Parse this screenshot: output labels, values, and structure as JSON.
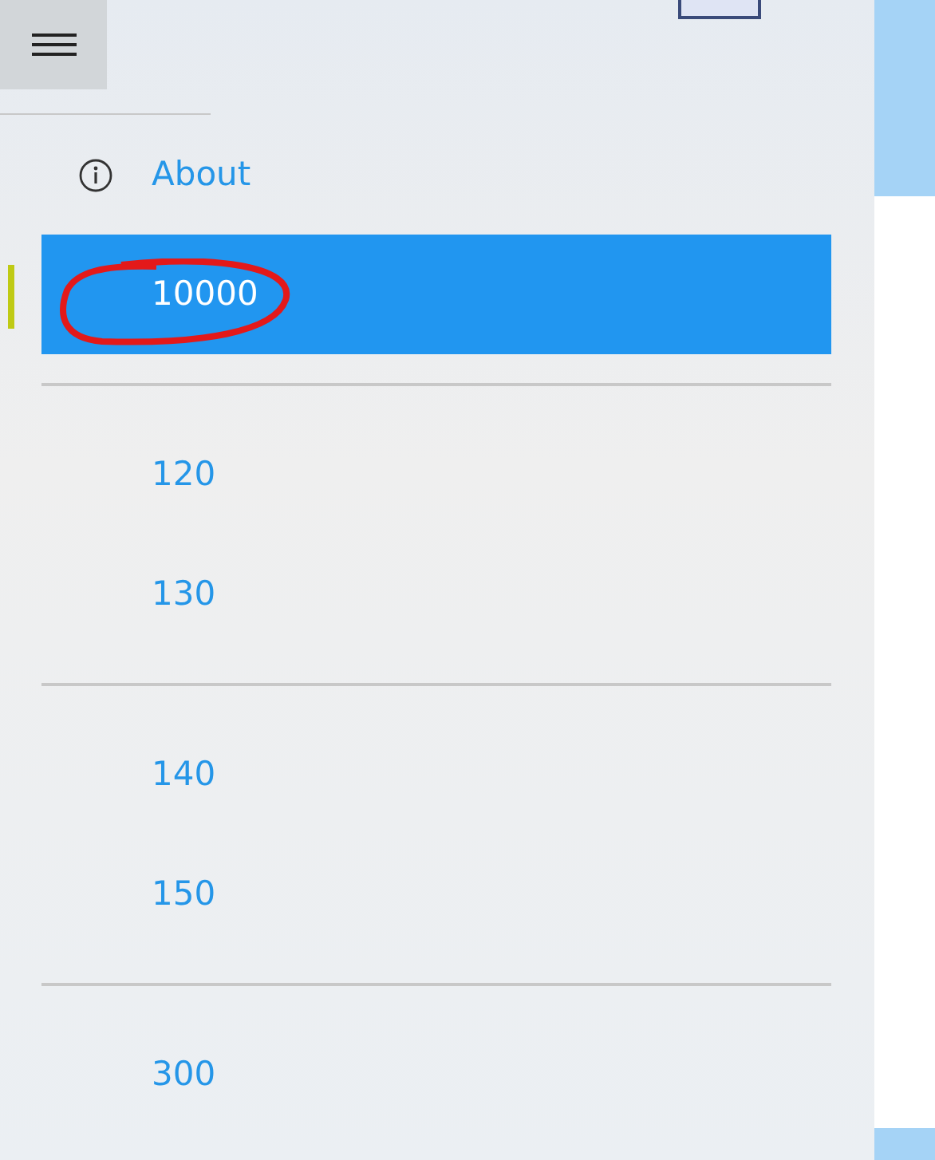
{
  "nav_pane": {
    "sections": [
      {
        "items": [
          {
            "label": "About",
            "kind": "info",
            "selected": false
          },
          {
            "label": "10000",
            "kind": "plain",
            "selected": true
          }
        ]
      },
      {
        "items": [
          {
            "label": "120",
            "kind": "plain",
            "selected": false
          },
          {
            "label": "130",
            "kind": "plain",
            "selected": false
          }
        ]
      },
      {
        "items": [
          {
            "label": "140",
            "kind": "plain",
            "selected": false
          },
          {
            "label": "150",
            "kind": "plain",
            "selected": false
          }
        ]
      },
      {
        "items": [
          {
            "label": "300",
            "kind": "plain",
            "selected": false
          }
        ]
      }
    ]
  }
}
